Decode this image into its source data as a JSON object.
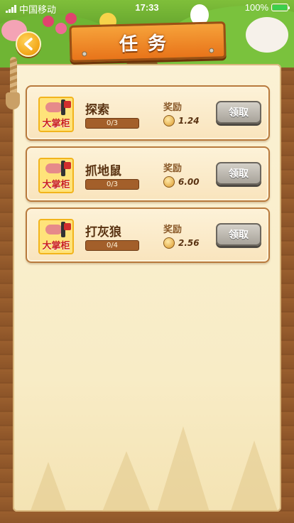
{
  "status_bar": {
    "carrier": "中国移动",
    "time": "17:33",
    "battery_percent": "100%",
    "battery_level": 1.0
  },
  "header": {
    "title": "任务"
  },
  "tasks": [
    {
      "name": "探索",
      "progress_text": "0/3",
      "progress": 0,
      "reward_label": "奖励",
      "reward_value": "1.24",
      "claim_label": "领取",
      "icon_text": "大掌柜"
    },
    {
      "name": "抓地鼠",
      "progress_text": "0/3",
      "progress": 0,
      "reward_label": "奖励",
      "reward_value": "6.00",
      "claim_label": "领取",
      "icon_text": "大掌柜"
    },
    {
      "name": "打灰狼",
      "progress_text": "0/4",
      "progress": 0,
      "reward_label": "奖励",
      "reward_value": "2.56",
      "claim_label": "领取",
      "icon_text": "大掌柜"
    }
  ],
  "icons": {
    "back": "chevron-left-icon",
    "coin": "coin-icon",
    "task": "task-logo-icon"
  },
  "colors": {
    "banner": "#e8741a",
    "wood": "#8a5226",
    "paper": "#fbf1d4",
    "claim_disabled": "#a8a39a"
  }
}
